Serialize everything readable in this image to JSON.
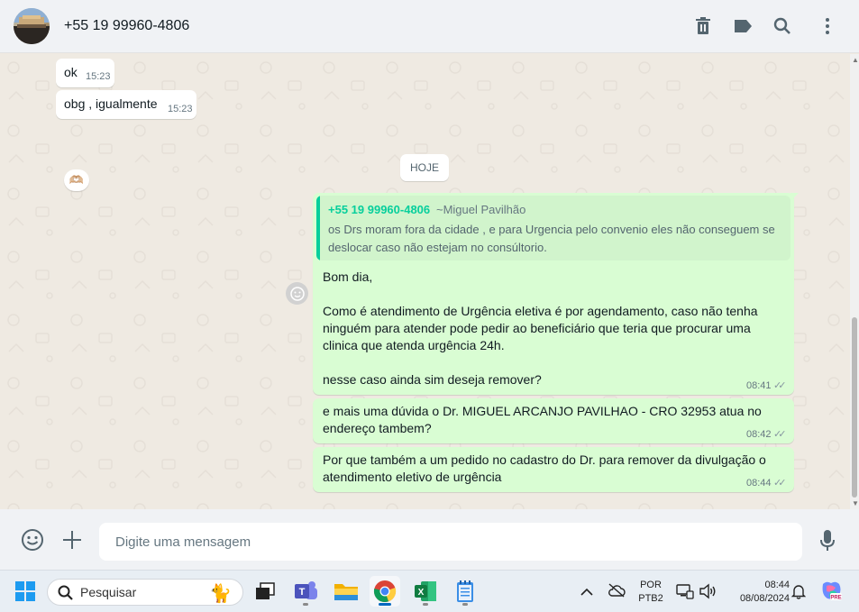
{
  "header": {
    "contact_name": "+55 19 99960-4806",
    "icons": [
      "delete-icon",
      "label-icon",
      "search-icon",
      "menu-icon"
    ]
  },
  "messages": {
    "in1": {
      "text": "ok",
      "time": "15:23"
    },
    "in2": {
      "text": "obg , igualmente",
      "time": "15:23",
      "reaction": "🫶🏼"
    },
    "date_separator": "HOJE",
    "out1": {
      "quote_author": "+55 19 99960-4806",
      "quote_alias": "~Miguel Pavilhão",
      "quote_text": "os Drs moram fora da cidade , e para Urgencia pelo convenio eles não conseguem se deslocar caso não estejam no consúltorio.",
      "text": "Bom dia,\n\nComo é atendimento de Urgência eletiva é por agendamento, caso não tenha ninguém para atender pode pedir ao beneficiário que teria que procurar uma clinica que atenda urgência 24h.\n\nnesse caso ainda sim deseja remover?",
      "time": "08:41"
    },
    "out2": {
      "text": "e mais uma dúvida o Dr. MIGUEL ARCANJO PAVILHAO - CRO 32953 atua no endereço tambem?",
      "time": "08:42"
    },
    "out3": {
      "text": "Por que também a um pedido no cadastro do Dr. para remover da divulgação o atendimento eletivo de urgência",
      "time": "08:44"
    }
  },
  "composer": {
    "placeholder": "Digite uma mensagem",
    "icons": [
      "emoji-icon",
      "attach-plus-icon",
      "microphone-icon"
    ]
  },
  "taskbar": {
    "search_placeholder": "Pesquisar",
    "language_top": "POR",
    "language_bottom": "PTB2",
    "clock_time": "08:44",
    "clock_date": "08/08/2024",
    "colors": {
      "accent": "#0067c0"
    }
  },
  "colors": {
    "outgoing_bubble": "#d9fdd3",
    "incoming_bubble": "#ffffff",
    "quote_accent": "#06cf9c",
    "chat_background": "#efeae2"
  }
}
